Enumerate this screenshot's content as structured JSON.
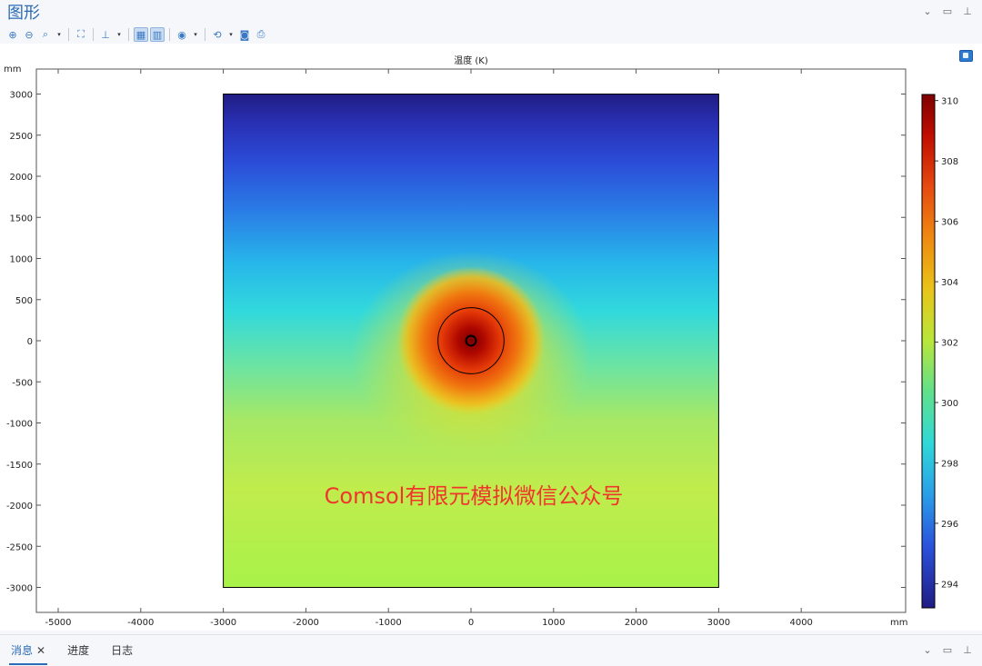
{
  "window": {
    "title": "图形",
    "controls": {
      "minimize": "⌄",
      "restore": "▭",
      "pin": "⊥"
    }
  },
  "toolbar": {
    "items": [
      {
        "icon": "zoom-in-icon",
        "glyph": "⊕"
      },
      {
        "icon": "zoom-out-icon",
        "glyph": "⊖"
      },
      {
        "icon": "zoom-box-icon",
        "glyph": "⌕"
      },
      {
        "icon": "zoom-extents-icon",
        "glyph": "⛶"
      },
      {
        "icon": "axis-orientation-icon",
        "glyph": "⊥"
      },
      {
        "icon": "grid-toggle-icon",
        "glyph": "▦"
      },
      {
        "icon": "show-legend-icon",
        "glyph": "▥"
      },
      {
        "icon": "scene-light-icon",
        "glyph": "◉"
      },
      {
        "icon": "reset-view-icon",
        "glyph": "⟲"
      },
      {
        "icon": "camera-icon",
        "glyph": "◙"
      },
      {
        "icon": "print-icon",
        "glyph": "⎙"
      }
    ],
    "arrow": "▾"
  },
  "plot": {
    "unit_label": "mm",
    "x_unit_label": "mm",
    "watermark": "Comsol有限元模拟微信公众号",
    "watermark_color": "#f0362c"
  },
  "chart_data": {
    "type": "heatmap",
    "title": "温度 (K)",
    "xlabel": "mm",
    "ylabel": "mm",
    "x_ticks": [
      "-5000",
      "-4000",
      "-3000",
      "-2000",
      "-1000",
      "0",
      "1000",
      "2000",
      "3000",
      "4000"
    ],
    "x_tick_values": [
      -5000,
      -4000,
      -3000,
      -2000,
      -1000,
      0,
      1000,
      2000,
      3000,
      4000
    ],
    "y_ticks": [
      "3000",
      "2500",
      "2000",
      "1500",
      "1000",
      "500",
      "0",
      "-500",
      "-1000",
      "-1500",
      "-2000",
      "-2500",
      "-3000"
    ],
    "y_tick_values": [
      3000,
      2500,
      2000,
      1500,
      1000,
      500,
      0,
      -500,
      -1000,
      -1500,
      -2000,
      -2500,
      -3000
    ],
    "xlim": [
      -5500,
      5000
    ],
    "ylim": [
      -3300,
      3300
    ],
    "domain": {
      "xmin": -3000,
      "xmax": 3000,
      "ymin": -3000,
      "ymax": 3000
    },
    "heat_source": {
      "x": 0,
      "y": 0,
      "inner_radius": 60,
      "outer_radius": 400,
      "peak_K": 310
    },
    "colorbar": {
      "ticks": [
        "310",
        "308",
        "306",
        "304",
        "302",
        "300",
        "298",
        "296",
        "294"
      ],
      "tick_values": [
        310,
        308,
        306,
        304,
        302,
        300,
        298,
        296,
        294
      ],
      "range": [
        293.2,
        310.2
      ],
      "colormap": "rainbow"
    }
  },
  "bottom": {
    "tabs": [
      {
        "label": "消息",
        "close": "✕",
        "active": true
      },
      {
        "label": "进度",
        "active": false
      },
      {
        "label": "日志",
        "active": false
      }
    ],
    "controls": {
      "minimize": "⌄",
      "restore": "▭",
      "pin": "⊥"
    }
  }
}
